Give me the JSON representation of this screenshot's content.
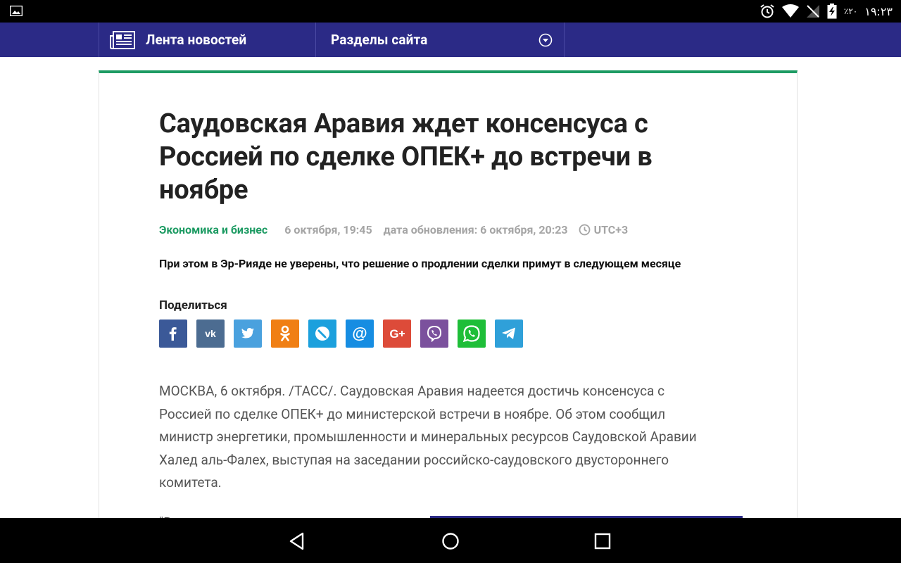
{
  "status_bar": {
    "battery_text": "٪۲۰",
    "time": "۱۹:۲۳",
    "icons": [
      "image-icon",
      "alarm-icon",
      "wifi-icon",
      "no-sim-icon",
      "battery-charging-icon"
    ]
  },
  "nav": {
    "news_feed_label": "Лента новостей",
    "sections_label": "Разделы сайта"
  },
  "article": {
    "title": "Саудовская Аравия ждет консенсуса с Россией по сделке ОПЕК+ до встречи в ноябре",
    "rubric": "Экономика и бизнес",
    "date": "6 октября, 19:45",
    "updated": "дата обновления: 6 октября, 20:23",
    "timezone": "UTC+3",
    "lead": "При этом в Эр-Рияде не уверены, что решение о продлении сделки примут в следующем месяце",
    "share_title": "Поделиться",
    "share_buttons": [
      {
        "name": "facebook",
        "color": "#3b5998",
        "glyph": "f"
      },
      {
        "name": "vkontakte",
        "color": "#4c6c91",
        "glyph": "vk"
      },
      {
        "name": "twitter",
        "color": "#4aa1de",
        "glyph": "twitter"
      },
      {
        "name": "odnoklassniki",
        "color": "#f07f14",
        "glyph": "ok"
      },
      {
        "name": "livejournal",
        "color": "#1ba0dd",
        "glyph": "lj"
      },
      {
        "name": "mail-ru",
        "color": "#168de2",
        "glyph": "@"
      },
      {
        "name": "google-plus",
        "color": "#dd4b39",
        "glyph": "G+"
      },
      {
        "name": "viber",
        "color": "#7b519d",
        "glyph": "viber"
      },
      {
        "name": "whatsapp",
        "color": "#1ebe38",
        "glyph": "whatsapp"
      },
      {
        "name": "telegram",
        "color": "#2fa0d9",
        "glyph": "telegram"
      }
    ],
    "body": "МОСКВА, 6 октября. /ТАСС/. Саудовская Аравия надеется достичь консенсуса с Россией по сделке ОПЕК+ до министерской встречи в ноябре. Об этом сообщил министр энергетики, промышленности и минеральных ресурсов Саудовской Аравии Халед аль-Фалех, выступая на заседании российско-саудовского двустороннего комитета.",
    "body_next_peek": "\"В"
  },
  "colors": {
    "nav_bg": "#2b2a86",
    "accent_green": "#1d9b63",
    "meta_gray": "#a5a5a5"
  }
}
